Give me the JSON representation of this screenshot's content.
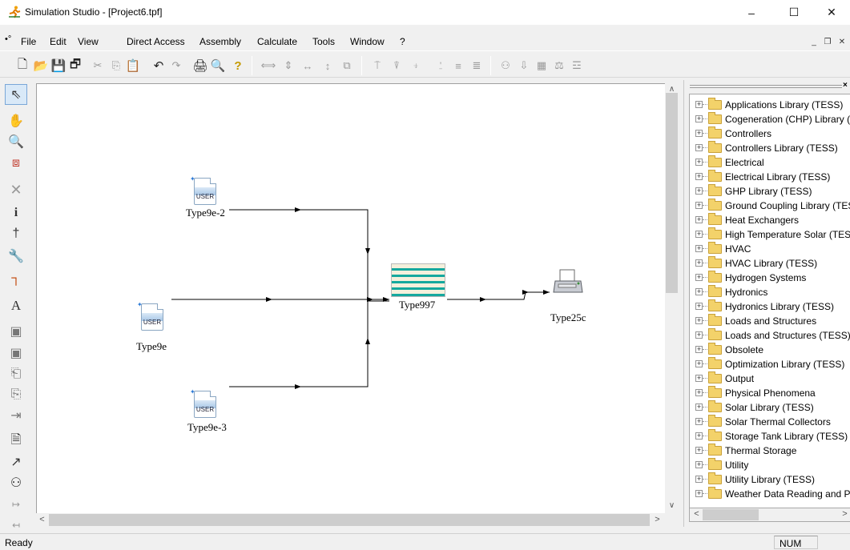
{
  "window": {
    "title": "Simulation Studio - [Project6.tpf]",
    "app_icon": "simulation-studio-runner-icon",
    "controls": [
      "minimize-icon",
      "maximize-icon",
      "close-icon"
    ],
    "minimize": "–",
    "maximize": "☐",
    "close": "✕"
  },
  "menubar": {
    "system_icon": "•°",
    "items": [
      "File",
      "Edit",
      "View",
      "Direct Access",
      "Assembly",
      "Calculate",
      "Tools",
      "Window",
      "?"
    ],
    "mdi_min": "_",
    "mdi_restore": "❐",
    "mdi_close": "✕"
  },
  "toolbar": {
    "buttons": [
      "new-icon",
      "open-icon",
      "save-icon",
      "save-all-icon",
      "cut-icon",
      "copy-icon",
      "paste-icon",
      "undo-icon",
      "redo-icon",
      "print-icon",
      "print-preview-icon",
      "help-icon",
      "space-horizontal-icon",
      "space-vertical-icon",
      "same-width-icon",
      "same-height-icon",
      "same-size-icon",
      "align-top-icon",
      "align-middle-icon",
      "align-bottom-icon",
      "align-left-icon",
      "align-center-icon",
      "align-right-icon",
      "tree-icon",
      "download-icon",
      "grid-icon",
      "weight-icon",
      "macro-icon"
    ],
    "glyphs": [
      "🗋",
      "📂",
      "💾",
      "🗗",
      "✂",
      "⎘",
      "📋",
      "↶",
      "↷",
      "🖨",
      "🔍",
      "?",
      "⟺",
      "⇕",
      "↔",
      "↕",
      "⧉",
      "⍑",
      "⍒",
      "⍖",
      "⍘",
      "≡",
      "≣",
      "⚇",
      "⇩",
      "▦",
      "⚖",
      "☲"
    ]
  },
  "palette": {
    "tools": [
      "pointer-icon",
      "hand-pan-icon",
      "zoom-icon",
      "zoom-window-icon",
      "delete-icon",
      "info-icon",
      "link-icon",
      "wrench-icon",
      "connection-icon",
      "text-tool-icon",
      "variable-icon",
      "variable2-icon",
      "folder-up-icon",
      "folder-down-icon",
      "export-icon",
      "document-icon",
      "arrow-icon",
      "runner-icon",
      "layer-in-icon",
      "layer-out-icon"
    ],
    "glyphs": [
      "⇖",
      "✋",
      "🔍",
      "⧈",
      "✕",
      "i",
      "†",
      "🔧",
      "┐",
      "A",
      "▣",
      "▣",
      "⎗",
      "⎘",
      "⇥",
      "🗎",
      "↗",
      "⚇",
      "↦",
      "↤"
    ]
  },
  "canvas": {
    "components": [
      {
        "id": "type9e-2",
        "label": "Type9e-2",
        "icon": "user-data-file-icon",
        "icon_text": "USER"
      },
      {
        "id": "type9e",
        "label": "Type9e",
        "icon": "user-data-file-icon",
        "icon_text": "USER"
      },
      {
        "id": "type9e-3",
        "label": "Type9e-3",
        "icon": "user-data-file-icon",
        "icon_text": "USER"
      },
      {
        "id": "type997",
        "label": "Type997",
        "icon": "storage-tank-icon"
      },
      {
        "id": "type25c",
        "label": "Type25c",
        "icon": "printer-icon"
      }
    ]
  },
  "scroll": {
    "up": "∧",
    "down": "∨",
    "left": "<",
    "right": ">"
  },
  "library_panel": {
    "close": "×",
    "tree": [
      "Applications Library (TESS)",
      "Cogeneration (CHP) Library (TESS)",
      "Controllers",
      "Controllers Library (TESS)",
      "Electrical",
      "Electrical Library (TESS)",
      "GHP Library (TESS)",
      "Ground Coupling Library (TESS)",
      "Heat Exchangers",
      "High Temperature Solar (TESS)",
      "HVAC",
      "HVAC Library (TESS)",
      "Hydrogen Systems",
      "Hydronics",
      "Hydronics Library (TESS)",
      "Loads and Structures",
      "Loads and Structures (TESS)",
      "Obsolete",
      "Optimization Library (TESS)",
      "Output",
      "Physical Phenomena",
      "Solar Library (TESS)",
      "Solar Thermal Collectors",
      "Storage Tank Library (TESS)",
      "Thermal Storage",
      "Utility",
      "Utility Library (TESS)",
      "Weather Data Reading and Processing"
    ],
    "expand_glyph": "+"
  },
  "statusbar": {
    "status": "Ready",
    "num": "NUM"
  }
}
